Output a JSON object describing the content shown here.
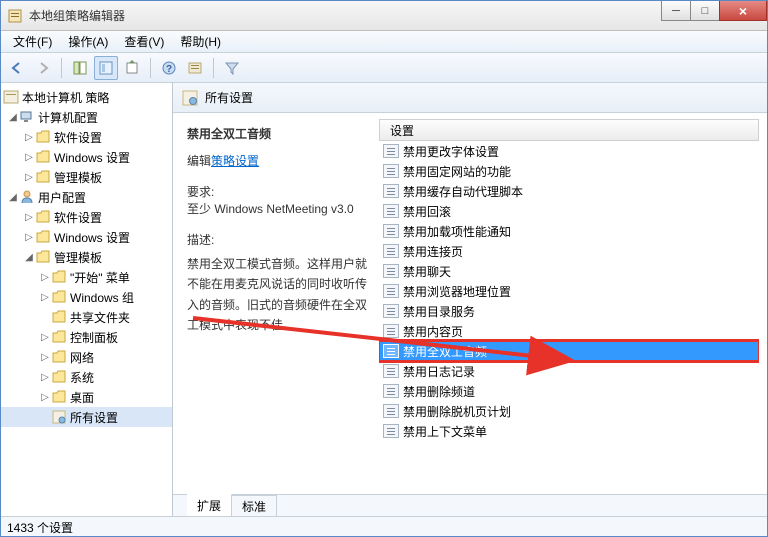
{
  "window": {
    "title": "本地组策略编辑器"
  },
  "menu": {
    "file": "文件(F)",
    "action": "操作(A)",
    "view": "查看(V)",
    "help": "帮助(H)"
  },
  "tree": {
    "root": "本地计算机 策略",
    "computer": "计算机配置",
    "sw1": "软件设置",
    "win1": "Windows 设置",
    "admin1": "管理模板",
    "user": "用户配置",
    "sw2": "软件设置",
    "win2": "Windows 设置",
    "admin2": "管理模板",
    "start": "\"开始\" 菜单",
    "wincomp": "Windows 组",
    "shared": "共享文件夹",
    "control": "控制面板",
    "network": "网络",
    "system": "系统",
    "desktop": "桌面",
    "all": "所有设置"
  },
  "content": {
    "header": "所有设置",
    "detail_title": "禁用全双工音频",
    "edit_prefix": "编辑",
    "edit_link": "策略设置",
    "req_label": "要求:",
    "req_text": "至少 Windows NetMeeting v3.0",
    "desc_label": "描述:",
    "desc_text": "禁用全双工模式音频。这样用户就不能在用麦克风说话的同时收听传入的音频。旧式的音频硬件在全双工模式中表现不佳。"
  },
  "list": {
    "header": "设置",
    "items": [
      "禁用更改字体设置",
      "禁用固定网站的功能",
      "禁用缓存自动代理脚本",
      "禁用回滚",
      "禁用加载项性能通知",
      "禁用连接页",
      "禁用聊天",
      "禁用浏览器地理位置",
      "禁用目录服务",
      "禁用内容页",
      "禁用全双工音频",
      "禁用日志记录",
      "禁用删除频道",
      "禁用删除脱机页计划",
      "禁用上下文菜单"
    ],
    "selected": 10
  },
  "tabs": {
    "extended": "扩展",
    "standard": "标准"
  },
  "status": "1433 个设置"
}
